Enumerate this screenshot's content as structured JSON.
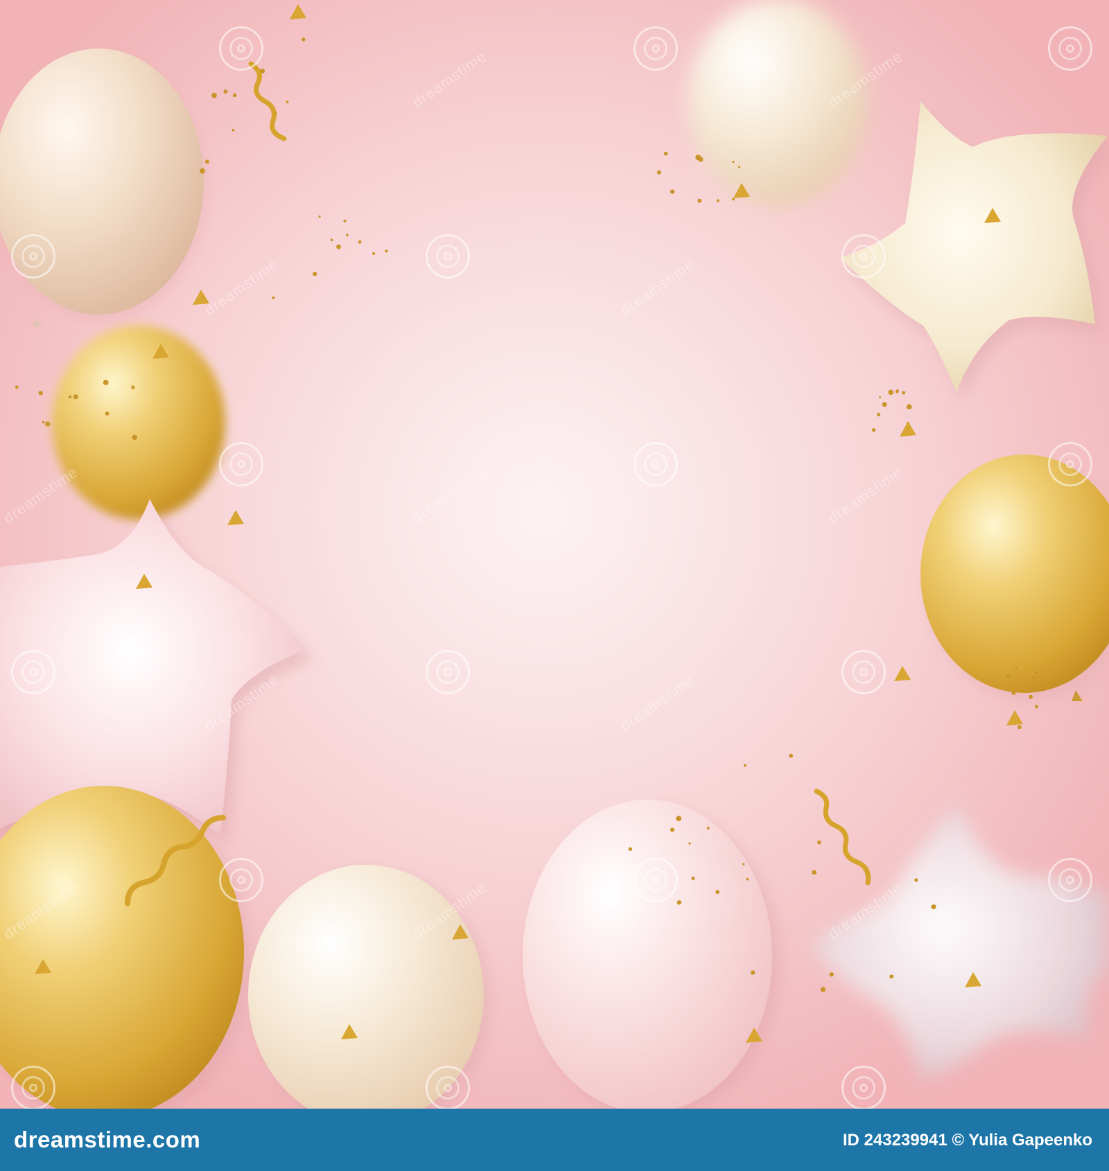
{
  "image": {
    "subject": "party balloons background",
    "background_color": "#f4c1c3",
    "center_glow_color": "#fdf0f1",
    "balloon_colors": {
      "gold": "#e7bb4f",
      "pearl": "#f6e7cf",
      "rose": "#f8d7db",
      "champagne": "#f3ddc4",
      "silver_rose": "#e2cfd6"
    },
    "watermark": {
      "text": "dreamstime",
      "icon": "spiral-watermark-icon"
    }
  },
  "footer": {
    "brand": "dreamstime.com",
    "image_id": "ID 243239941",
    "copyright_symbol": "©",
    "author": "Yulia Gapeenko",
    "background_color": "#1d75a8"
  }
}
